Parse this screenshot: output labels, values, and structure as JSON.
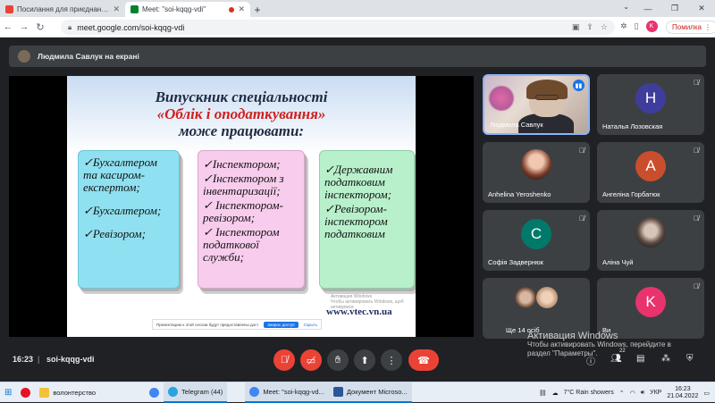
{
  "browser": {
    "tabs": [
      {
        "title": "Посилання для приєднання до ...",
        "favicon_color": "#ea4335"
      },
      {
        "title": "Meet: \"soi-kqqg-vdi\"",
        "favicon_color": "#00832d"
      }
    ],
    "new_tab": "+",
    "url": "meet.google.com/soi-kqqg-vdi",
    "error_button": "Помилка",
    "profile_initial": "K"
  },
  "meet": {
    "presenter_banner": "Людмила Савлук на екрані",
    "slide": {
      "title_line1": "Випускник спеціальності",
      "title_line2": "«Облік і оподаткування»",
      "title_line3": "може працювати:",
      "col1": [
        "✓Бухгалтером та касиром-експертом;",
        "✓Бухгалтером;",
        "✓Ревізором;"
      ],
      "col2": [
        "✓Інспектором;",
        "✓Інспектором з інвентаризації;",
        "✓ Інспектором-ревізором;",
        "✓ Інспектором податкової служби;"
      ],
      "col3": [
        "✓Державним податковим інспектором;",
        "✓Ревізором-інспектором податковим"
      ],
      "website": "www.vtec.vn.ua",
      "bar_text": "Презентацию к этой сессии будут предоставлены доступ к вашему горизонту",
      "bar_button": "Запрос доступ",
      "bar_link": "Скрыть",
      "overlay_line1": "Активация Windows",
      "overlay_line2": "Чтобы активировать Windows, щоб активувати"
    },
    "participants": [
      {
        "name": "Людмила Савлук",
        "type": "camera"
      },
      {
        "name": "Наталья Лозовская",
        "initial": "Н",
        "color": "#3f3d9c"
      },
      {
        "name": "Anhelina Yeroshenko",
        "type": "photo",
        "color": "#c8846a"
      },
      {
        "name": "Ангеліна Горбатюк",
        "initial": "А",
        "color": "#c94f2c"
      },
      {
        "name": "Софія Задвернюк",
        "initial": "С",
        "color": "#00796b"
      },
      {
        "name": "Аліна Чуй",
        "type": "photo",
        "color": "#8c7c70"
      },
      {
        "name": "Ще 14 осіб",
        "type": "more"
      },
      {
        "name": "Ви",
        "initial": "K",
        "color": "#e8336d"
      }
    ],
    "windows_activation": {
      "title": "Активация Windows",
      "line1": "Чтобы активировать Windows, перейдите в",
      "line2": "раздел \"Параметры\"."
    },
    "controls": {
      "time": "16:23",
      "separator": "|",
      "meeting_code": "soi-kqqg-vdi",
      "participants_count": "22"
    }
  },
  "taskbar": {
    "items": [
      {
        "label": "",
        "color": "#e81123",
        "open": false
      },
      {
        "label": "волонтерство",
        "color": "#f3c13a",
        "open": false
      },
      {
        "label": "",
        "color": "#4285f4",
        "open": false
      },
      {
        "label": "Telegram (44)",
        "color": "#2aa3df",
        "open": true
      },
      {
        "label": "Meet: \"soi-kqqg-vd...",
        "color": "#4285f4",
        "open": true
      },
      {
        "label": "Документ Microso...",
        "color": "#2b579a",
        "open": true
      }
    ],
    "weather": "7°C  Rain showers",
    "language": "УКР",
    "time": "16:23",
    "date": "21.04.2022"
  }
}
